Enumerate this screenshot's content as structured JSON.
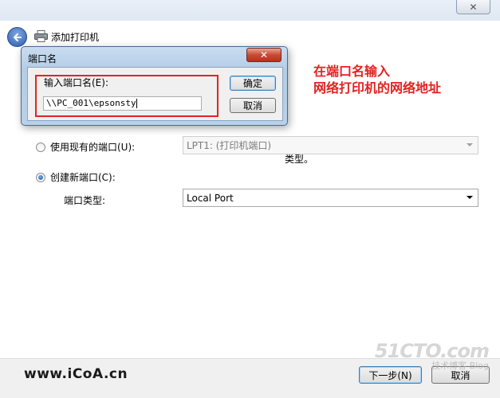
{
  "wizard": {
    "title": "添加打印机",
    "close_glyph": "✕",
    "partial_text": "类型。",
    "use_existing_port_label": "使用现有的端口(U):",
    "use_existing_port_value": "LPT1: (打印机端口)",
    "create_new_port_label": "创建新端口(C):",
    "port_type_label": "端口类型:",
    "port_type_value": "Local Port",
    "next_button": "下一步(N)",
    "cancel_button": "取消"
  },
  "dialog": {
    "title": "端口名",
    "close_glyph": "✕",
    "input_label": "输入端口名(E):",
    "input_value": "\\\\PC_001\\epsonsty",
    "ok_button": "确定",
    "cancel_button": "取消"
  },
  "annotation": {
    "line1": "在端口名输入",
    "line2": "网络打印机的网络地址"
  },
  "watermarks": {
    "left": "www.iCoA.cn",
    "right_main": "51CTO.com",
    "right_sub": "技术博客  Blog"
  },
  "colors": {
    "annotation": "#e32222",
    "highlight_box": "#e02424",
    "dialog_frame": "#b9d1e8",
    "close_button": "#c94a33"
  },
  "icons": [
    "back-arrow-icon",
    "printer-icon",
    "close-icon"
  ],
  "state": {
    "selected_port_option": "create_new_port"
  }
}
